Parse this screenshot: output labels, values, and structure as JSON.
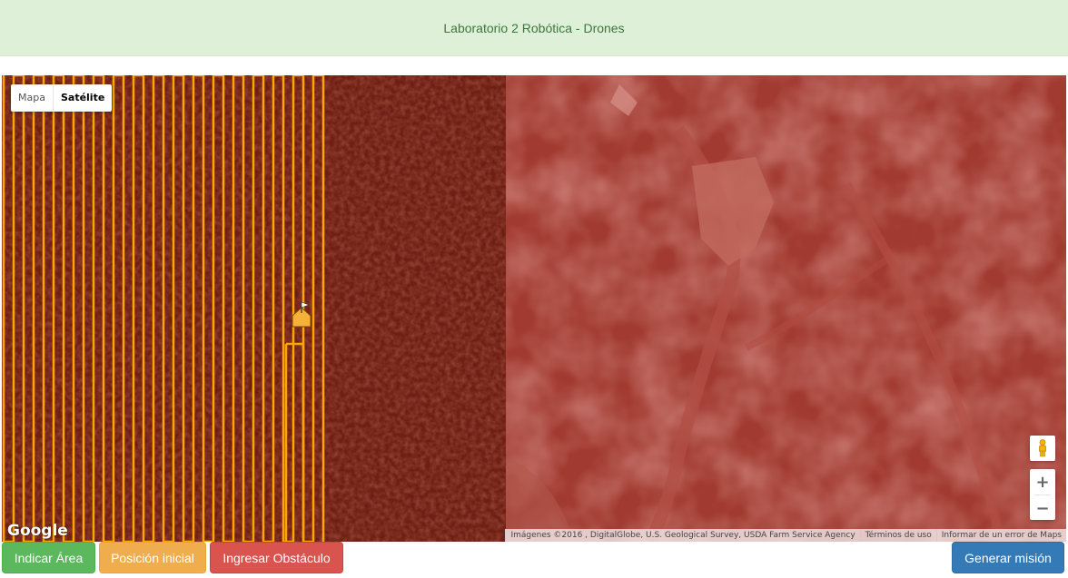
{
  "header": {
    "title": "Laboratorio 2 Robótica - Drones"
  },
  "map": {
    "type_control": {
      "map_label": "Mapa",
      "satellite_label": "Satélite",
      "selected": "Satélite"
    },
    "zoom": {
      "in_label": "+",
      "out_label": "−"
    },
    "logo": "Google",
    "attribution": {
      "imagery": "Imágenes ©2016 , DigitalGlobe, U.S. Geological Survey, USDA Farm Service Agency",
      "terms": "Términos de uso",
      "report": "Informar de un error de Maps"
    },
    "icons": {
      "pegman": "pegman-icon",
      "start_marker": "home-marker-icon",
      "flag": "flag-icon"
    },
    "colors": {
      "path": "#ffa500",
      "overlay": "#a31a10"
    }
  },
  "actions": {
    "indicate_area": "Indicar Área",
    "start_position": "Posición inicial",
    "add_obstacle": "Ingresar Obstáculo",
    "generate_mission": "Generar misión"
  },
  "colors": {
    "header_bg": "#dff0d8",
    "header_text": "#3c763d",
    "success": "#5cb85c",
    "warning": "#f0ad4e",
    "danger": "#d9534f",
    "primary": "#337ab7"
  }
}
